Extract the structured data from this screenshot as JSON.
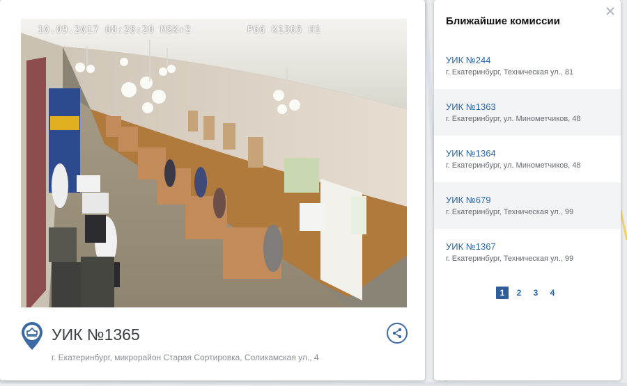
{
  "video": {
    "timestamp": "10.09.2017 08:28:20 MSK+2",
    "camera": "P66 K1365 H1"
  },
  "commission": {
    "title": "УИК №1365",
    "address": "г. Екатеринбург, микрорайон Старая Сортировка, Соликамская ул., 4"
  },
  "icons": {
    "marker": "ballot-box-marker-icon",
    "share": "share-icon",
    "close": "close-icon"
  },
  "nearby": {
    "title": "Ближайшие комиссии",
    "items": [
      {
        "title": "УИК №244",
        "address": "г. Екатеринбург, Техническая ул., 81"
      },
      {
        "title": "УИК №1363",
        "address": "г. Екатеринбург, ул. Минометчиков, 48"
      },
      {
        "title": "УИК №1364",
        "address": "г. Екатеринбург, ул. Минометчиков, 48"
      },
      {
        "title": "УИК №679",
        "address": "г. Екатеринбург, Техническая ул., 99"
      },
      {
        "title": "УИК №1367",
        "address": "г. Екатеринбург, Техническая ул., 99"
      }
    ],
    "pages": [
      "1",
      "2",
      "3",
      "4"
    ],
    "current_page": "1"
  },
  "colors": {
    "accent": "#2f5d9c",
    "link": "#2a66a8"
  }
}
